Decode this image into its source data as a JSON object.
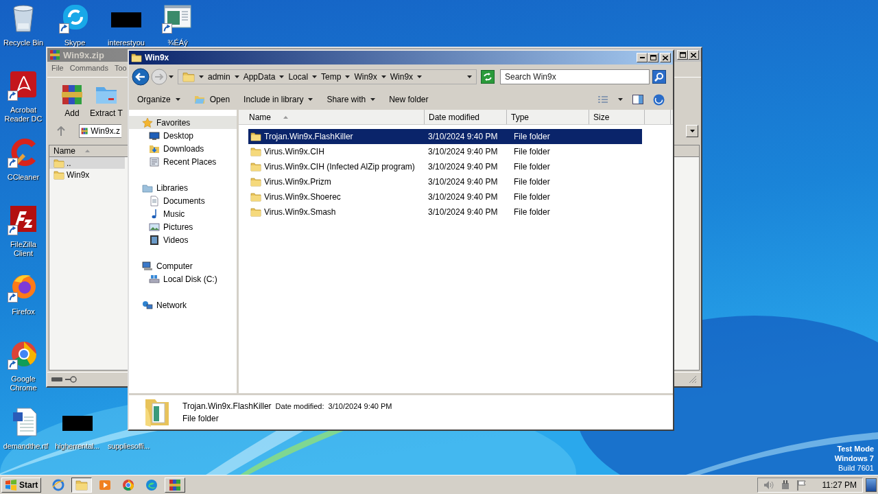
{
  "desktop": {
    "icons": [
      {
        "label": "Recycle Bin",
        "kind": "recycle-bin",
        "shortcut": false
      },
      {
        "label": "Skype",
        "kind": "skype",
        "shortcut": true
      },
      {
        "label": "interestyou",
        "kind": "redacted",
        "shortcut": false
      },
      {
        "label": "¾ÉÁý",
        "kind": "window-doc",
        "shortcut": true
      },
      {
        "label": "Acrobat Reader DC",
        "kind": "acrobat",
        "shortcut": true
      },
      {
        "label": "CCleaner",
        "kind": "ccleaner",
        "shortcut": true
      },
      {
        "label": "FileZilla Client",
        "kind": "filezilla",
        "shortcut": true
      },
      {
        "label": "Firefox",
        "kind": "firefox",
        "shortcut": true
      },
      {
        "label": "Google Chrome",
        "kind": "chrome",
        "shortcut": true
      },
      {
        "label": "demandthe.rtf",
        "kind": "word",
        "shortcut": false
      },
      {
        "label": "higherrental...",
        "kind": "redacted",
        "shortcut": false
      },
      {
        "label": "suppliesoffi..."
      }
    ],
    "watermark": [
      "Test Mode",
      "Windows 7",
      "Build 7601"
    ]
  },
  "archive_window": {
    "title": "Win9x.zip",
    "menu": [
      "File",
      "Commands",
      "Too"
    ],
    "toolbar": [
      {
        "label": "Add",
        "kind": "add"
      },
      {
        "label": "Extract T",
        "kind": "extract"
      }
    ],
    "path": "Win9x.z",
    "columns": [
      {
        "label": "Name",
        "sorted": true
      }
    ],
    "rows": [
      {
        "name": "..",
        "selected": true
      },
      {
        "name": "Win9x",
        "selected": false
      }
    ]
  },
  "explorer_window": {
    "title": "Win9x",
    "breadcrumbs": [
      "admin",
      "AppData",
      "Local",
      "Temp",
      "Win9x",
      "Win9x"
    ],
    "search": {
      "placeholder": "Search Win9x"
    },
    "commands": [
      {
        "label": "Organize",
        "kind": "text",
        "dropdown": true
      },
      {
        "label": "Open",
        "kind": "open",
        "dropdown": false
      },
      {
        "label": "Include in library",
        "kind": "text",
        "dropdown": true
      },
      {
        "label": "Share with",
        "kind": "text",
        "dropdown": true
      },
      {
        "label": "New folder",
        "kind": "text",
        "dropdown": false
      }
    ],
    "navigation": [
      {
        "label": "Favorites",
        "kind": "favorites",
        "selected": true,
        "children": [
          {
            "label": "Desktop",
            "kind": "desktop",
            "selected": false
          },
          {
            "label": "Downloads",
            "kind": "downloads",
            "selected": false
          },
          {
            "label": "Recent Places",
            "kind": "recent",
            "selected": false
          }
        ]
      },
      {
        "label": "Libraries",
        "kind": "libraries",
        "selected": false,
        "children": [
          {
            "label": "Documents",
            "kind": "documents",
            "selected": false
          },
          {
            "label": "Music",
            "kind": "music",
            "selected": false
          },
          {
            "label": "Pictures",
            "kind": "pictures",
            "selected": false
          },
          {
            "label": "Videos",
            "kind": "videos",
            "selected": false
          }
        ]
      },
      {
        "label": "Computer",
        "kind": "computer",
        "selected": false,
        "children": [
          {
            "label": "Local Disk (C:)",
            "kind": "disk",
            "selected": false
          }
        ]
      },
      {
        "label": "Network",
        "kind": "network",
        "selected": false
      }
    ],
    "columns": [
      {
        "label": "Name",
        "sorted": true
      },
      {
        "label": "Date modified",
        "sorted": false
      },
      {
        "label": "Type",
        "sorted": false
      },
      {
        "label": "Size",
        "sorted": false
      }
    ],
    "rows": [
      {
        "name": "Trojan.Win9x.FlashKiller",
        "date_modified": "3/10/2024 9:40 PM",
        "type": "File folder",
        "selected": true
      },
      {
        "name": "Virus.Win9x.CIH",
        "date_modified": "3/10/2024 9:40 PM",
        "type": "File folder",
        "selected": false
      },
      {
        "name": "Virus.Win9x.CIH (Infected AlZip program)",
        "date_modified": "3/10/2024 9:40 PM",
        "type": "File folder",
        "selected": false
      },
      {
        "name": "Virus.Win9x.Prizm",
        "date_modified": "3/10/2024 9:40 PM",
        "type": "File folder",
        "selected": false
      },
      {
        "name": "Virus.Win9x.Shoerec",
        "date_modified": "3/10/2024 9:40 PM",
        "type": "File folder",
        "selected": false
      },
      {
        "name": "Virus.Win9x.Smash",
        "date_modified": "3/10/2024 9:40 PM",
        "type": "File folder",
        "selected": false
      }
    ],
    "details": {
      "name": "Trojan.Win9x.FlashKiller",
      "date_label": "Date modified:",
      "date": "3/10/2024 9:40 PM",
      "type": "File folder"
    }
  },
  "taskbar": {
    "start": "Start",
    "apps": [
      {
        "kind": "internet-explorer",
        "running": false,
        "selected": false
      },
      {
        "kind": "explorer",
        "running": true,
        "selected": true
      },
      {
        "kind": "media-player",
        "running": false,
        "selected": false
      },
      {
        "kind": "chrome",
        "running": false,
        "selected": false
      },
      {
        "kind": "edge",
        "running": false,
        "selected": false
      },
      {
        "kind": "winrar",
        "running": true,
        "selected": false
      }
    ],
    "clock": "11:27 PM"
  }
}
